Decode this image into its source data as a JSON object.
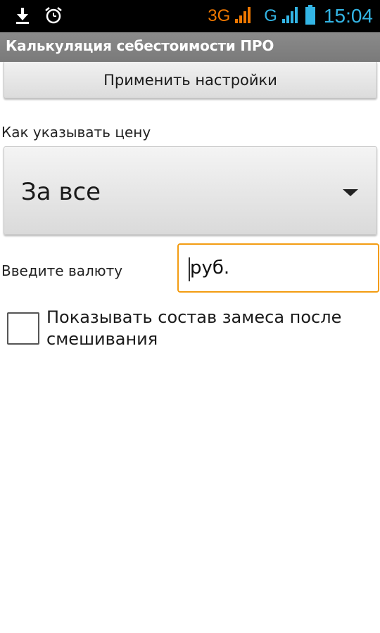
{
  "status_bar": {
    "network_1": "3G",
    "network_2": "G",
    "time": "15:04",
    "icons": [
      "download-icon",
      "alarm-icon",
      "signal-icon",
      "signal-icon",
      "battery-icon"
    ]
  },
  "title_bar": {
    "title": "Калькуляция себестоимости ПРО"
  },
  "settings": {
    "apply_button": "Применить настройки",
    "price_label": "Как указывать цену",
    "price_mode_selected": "За все",
    "currency_label": "Введите валюту",
    "currency_value": "руб.",
    "show_mix_label": "Показывать состав замеса после смешивания",
    "show_mix_checked": false
  },
  "colors": {
    "accent_orange": "#f39c12",
    "status_blue": "#33b5e5",
    "status_orange": "#f07800",
    "title_bar_bg": "#808080"
  }
}
